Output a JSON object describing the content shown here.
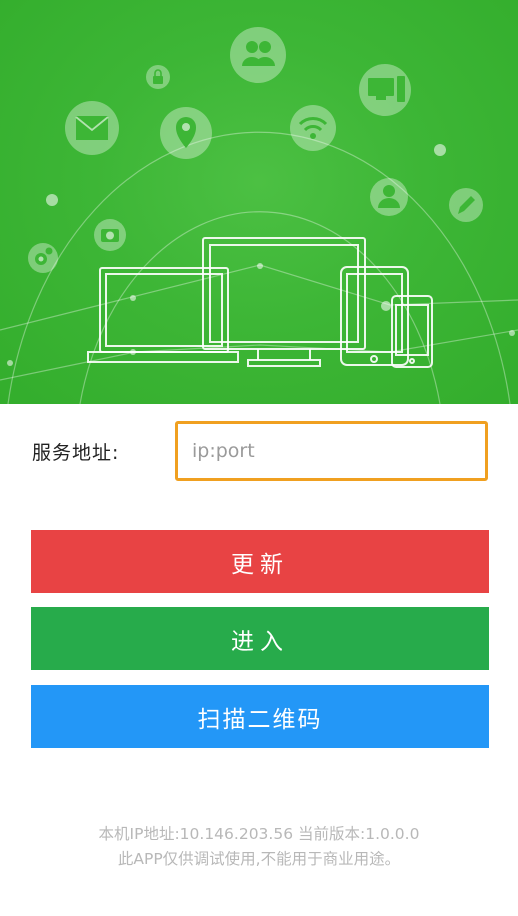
{
  "form": {
    "address_label": "服务地址:",
    "address_placeholder": "ip:port",
    "address_value": ""
  },
  "buttons": {
    "update_label": "更新",
    "enter_label": "进入",
    "scan_label": "扫描二维码"
  },
  "footer": {
    "line1": "本机IP地址:10.146.203.56  当前版本:1.0.0.0",
    "line2": "此APP仅供调试使用,不能用于商业用途。"
  },
  "colors": {
    "hero_green": "#3db636",
    "input_border": "#f0a020",
    "update_button": "#e84344",
    "enter_button": "#27ab4b",
    "scan_button": "#2397f7"
  },
  "icons": [
    "lock-icon",
    "users-icon",
    "computer-icon",
    "mail-icon",
    "location-icon",
    "wifi-icon",
    "user-icon",
    "pencil-icon",
    "camera-icon",
    "settings-icon"
  ]
}
